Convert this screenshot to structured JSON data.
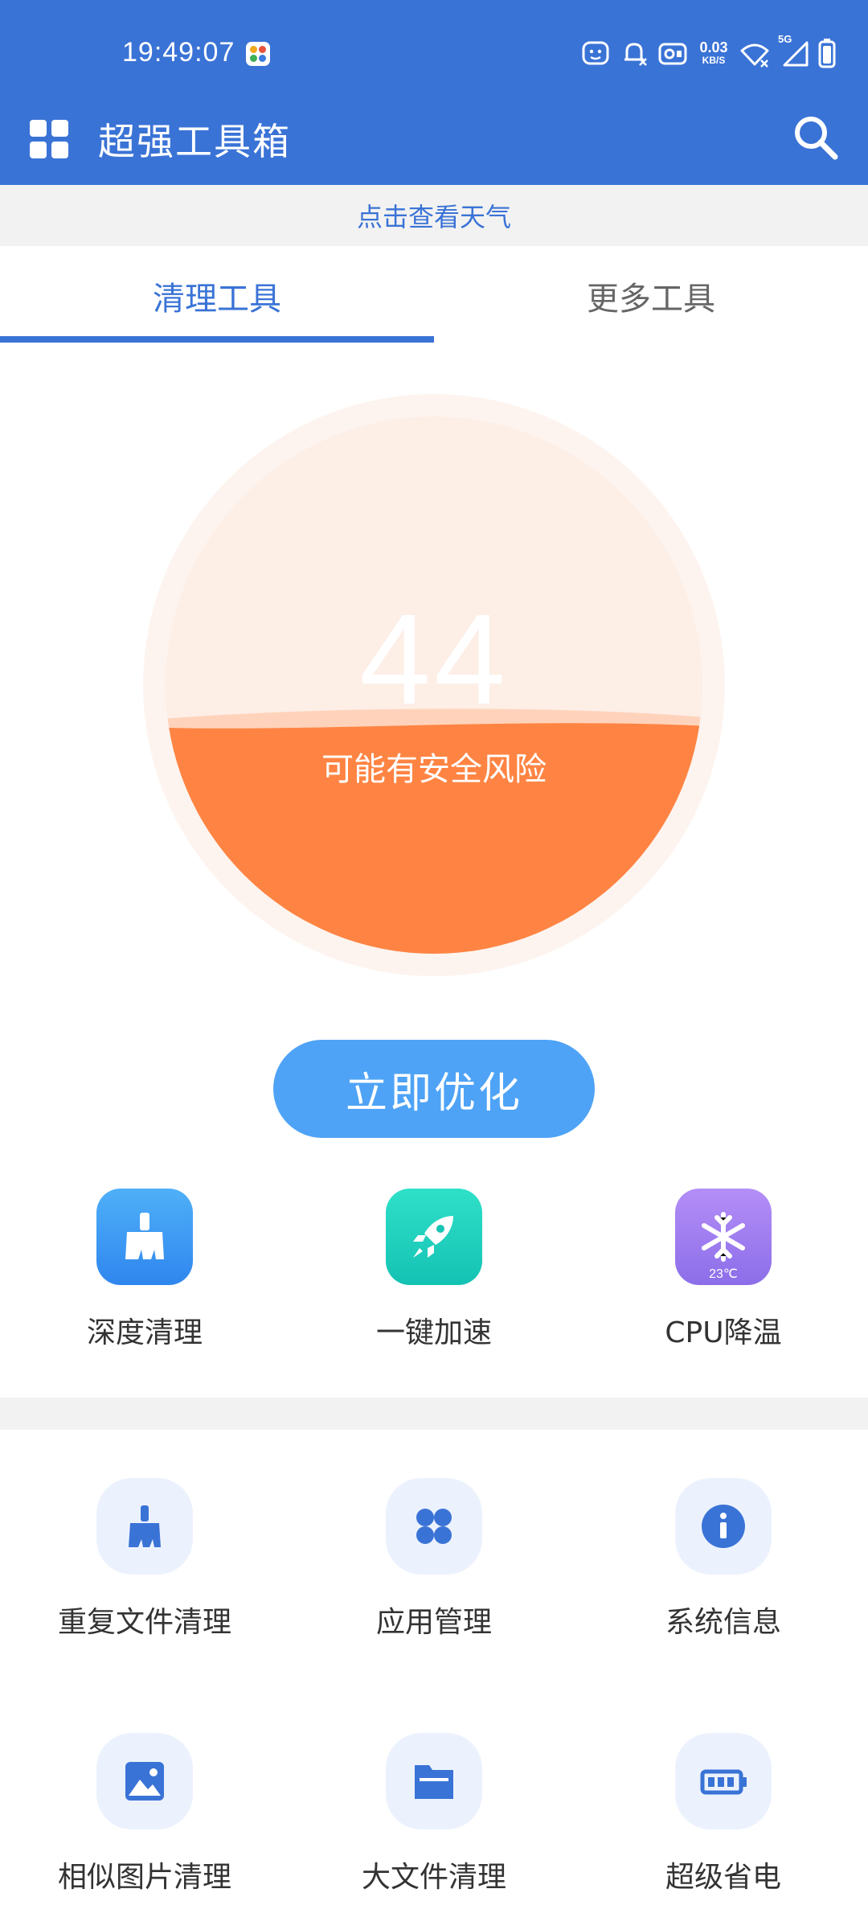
{
  "status_bar": {
    "time": "19:49:07",
    "net_speed_value": "0.03",
    "net_speed_unit": "KB/S",
    "network_gen": "5G",
    "icons": [
      "face-notification-icon",
      "bell-muted-icon",
      "vpn-icon",
      "wifi-icon",
      "signal-icon",
      "battery-icon"
    ]
  },
  "app_bar": {
    "title": "超强工具箱",
    "menu_icon": "grid-menu-icon",
    "search_icon": "search-icon"
  },
  "weather": {
    "text": "点击查看天气"
  },
  "tabs": [
    {
      "label": "清理工具",
      "active": true
    },
    {
      "label": "更多工具",
      "active": false
    }
  ],
  "gauge": {
    "score": "44",
    "status": "可能有安全风险",
    "fill_level": 0.44,
    "colors": {
      "fill": "#ff8443",
      "background": "#fdeee6",
      "ring": "#fdf4ef"
    }
  },
  "optimize_button": {
    "label": "立即优化",
    "color": "#4ea3f6"
  },
  "quick_tools": [
    {
      "label": "深度清理",
      "icon": "broom-icon",
      "color": "#3d9cf5"
    },
    {
      "label": "一键加速",
      "icon": "rocket-icon",
      "color": "#1fc9b8"
    },
    {
      "label": "CPU降温",
      "icon": "snowflake-icon",
      "color": "#9c7cf0",
      "badge": "23℃"
    }
  ],
  "more_tools_row1": [
    {
      "label": "重复文件清理",
      "icon": "broom-icon"
    },
    {
      "label": "应用管理",
      "icon": "apps-icon"
    },
    {
      "label": "系统信息",
      "icon": "info-icon"
    }
  ],
  "more_tools_row2": [
    {
      "label": "相似图片清理",
      "icon": "image-icon"
    },
    {
      "label": "大文件清理",
      "icon": "folder-icon"
    },
    {
      "label": "超级省电",
      "icon": "battery-icon"
    }
  ],
  "colors": {
    "primary": "#3a73d6",
    "strip_bg": "#f2f2f2",
    "light_tile": "#ecf2fd"
  }
}
